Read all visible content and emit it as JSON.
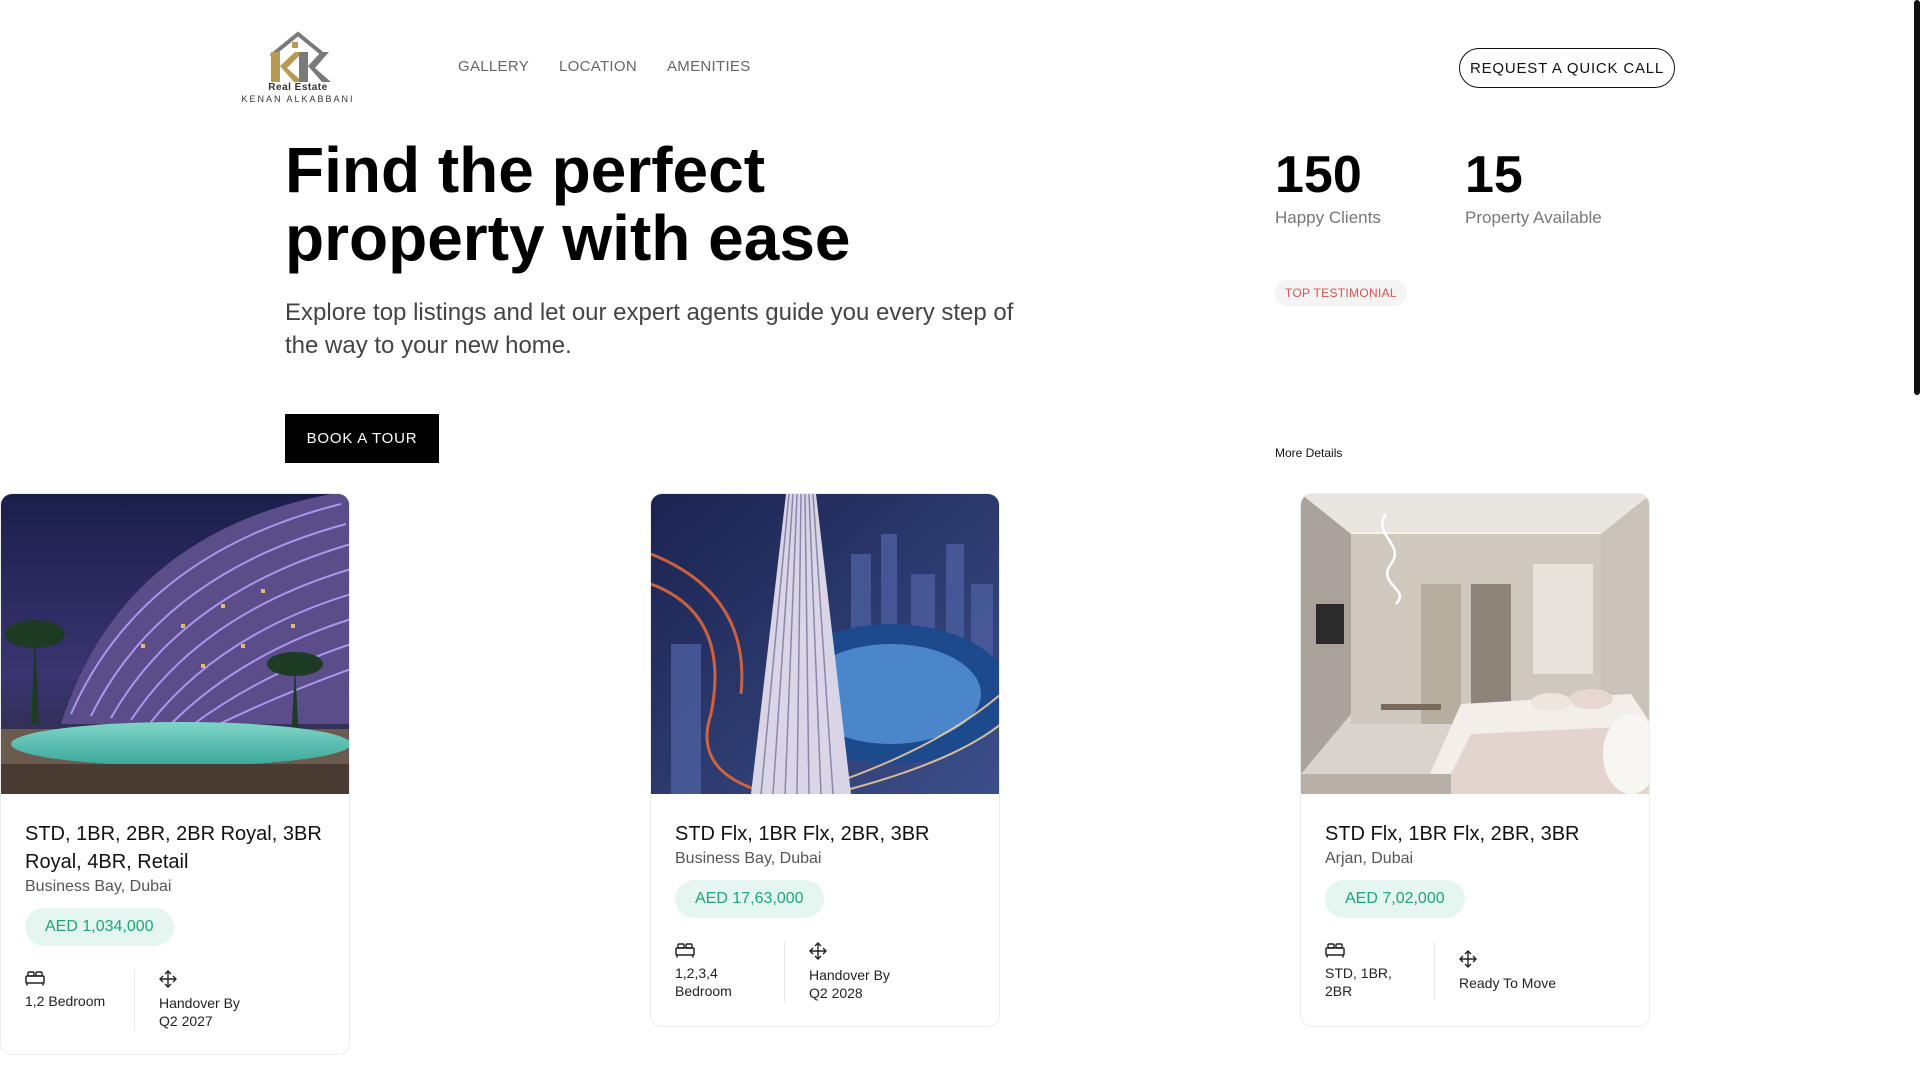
{
  "brand": {
    "tagline": "Real Estate",
    "name": "KENAN ALKABBANI",
    "colors": {
      "gold": "#b79a52",
      "gray": "#7a7a7a"
    }
  },
  "nav": {
    "items": [
      {
        "label": "GALLERY"
      },
      {
        "label": "LOCATION"
      },
      {
        "label": "AMENITIES"
      }
    ]
  },
  "header": {
    "cta_label": "REQUEST A QUICK CALL"
  },
  "hero": {
    "title": "Find the perfect property with ease",
    "subtitle": "Explore top listings and let our expert agents guide you every step of the way to your new home.",
    "cta_label": "BOOK A TOUR"
  },
  "stats": [
    {
      "value": "150",
      "label": "Happy Clients"
    },
    {
      "value": "15",
      "label": "Property Available"
    }
  ],
  "testimonial": {
    "badge": "TOP TESTIMONIAL",
    "link_label": "More Details"
  },
  "listings": [
    {
      "title": "STD, 1BR, 2BR, 2BR Royal, 3BR Royal, 4BR, Retail",
      "location": "Business Bay, Dubai",
      "price": "AED 1,034,000",
      "bedrooms": "1,2 Bedroom",
      "handover": "Handover By Q2 2027",
      "image": "resort-tower-pool-night"
    },
    {
      "title": "STD Flx, 1BR Flx, 2BR, 3BR",
      "location": "Business Bay, Dubai",
      "price": "AED 17,63,000",
      "bedrooms": "1,2,3,4 Bedroom",
      "handover": "Handover By Q2 2028",
      "image": "skyscraper-aerial-night"
    },
    {
      "title": "STD Flx, 1BR Flx, 2BR, 3BR",
      "location": "Arjan, Dubai",
      "price": "AED 7,02,000",
      "bedrooms": "STD, 1BR, 2BR",
      "handover": "Ready To Move",
      "image": "bedroom-interior"
    }
  ],
  "icons": {
    "bed": "bed-icon",
    "move": "move-arrows-icon"
  },
  "accent": {
    "price_bg": "#e4f6ef",
    "price_text": "#1ea57a",
    "badge_text": "#d9534f"
  }
}
